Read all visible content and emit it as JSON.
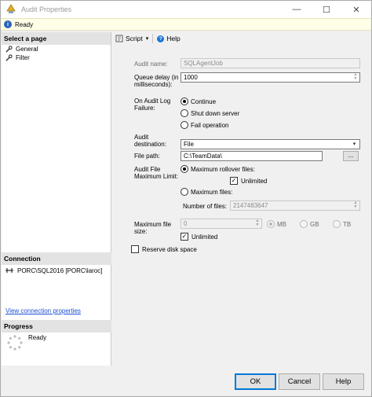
{
  "window": {
    "title": "Audit Properties",
    "minimize": "—",
    "maximize": "☐",
    "close": "✕"
  },
  "status": {
    "text": "Ready"
  },
  "left": {
    "select_page_header": "Select a page",
    "pages": [
      {
        "label": "General"
      },
      {
        "label": "Filter"
      }
    ],
    "connection_header": "Connection",
    "connection_text": "PORC\\SQL2016 [PORC\\laroc]",
    "view_connection_link": "View connection properties",
    "progress_header": "Progress",
    "progress_text": "Ready"
  },
  "toolbar": {
    "script_label": "Script",
    "script_arrow": "▾",
    "help_label": "Help"
  },
  "form": {
    "audit_name_label": "Audit name:",
    "audit_name_value": "SQLAgentJob",
    "queue_delay_label": "Queue delay (in milliseconds):",
    "queue_delay_value": "1000",
    "on_failure_label": "On Audit Log Failure:",
    "failure_options": [
      "Continue",
      "Shut down server",
      "Fail operation"
    ],
    "destination_label": "Audit destination:",
    "destination_value": "File",
    "file_path_label": "File path:",
    "file_path_value": "C:\\TeamData\\",
    "browse_label": "...",
    "max_limit_label": "Audit File Maximum Limit:",
    "max_rollover_label": "Maximum rollover files:",
    "unlimited_label": "Unlimited",
    "max_files_label": "Maximum files:",
    "number_of_files_label": "Number of files:",
    "number_of_files_value": "2147483647",
    "max_file_size_label": "Maximum file size:",
    "max_file_size_value": "0",
    "size_units": [
      "MB",
      "GB",
      "TB"
    ],
    "unlimited2_label": "Unlimited",
    "reserve_label": "Reserve disk space"
  },
  "buttons": {
    "ok": "OK",
    "cancel": "Cancel",
    "help": "Help"
  },
  "colors": {
    "accent": "#0078d7",
    "link": "#1a4fd0",
    "status_bg": "#ffffe8"
  }
}
